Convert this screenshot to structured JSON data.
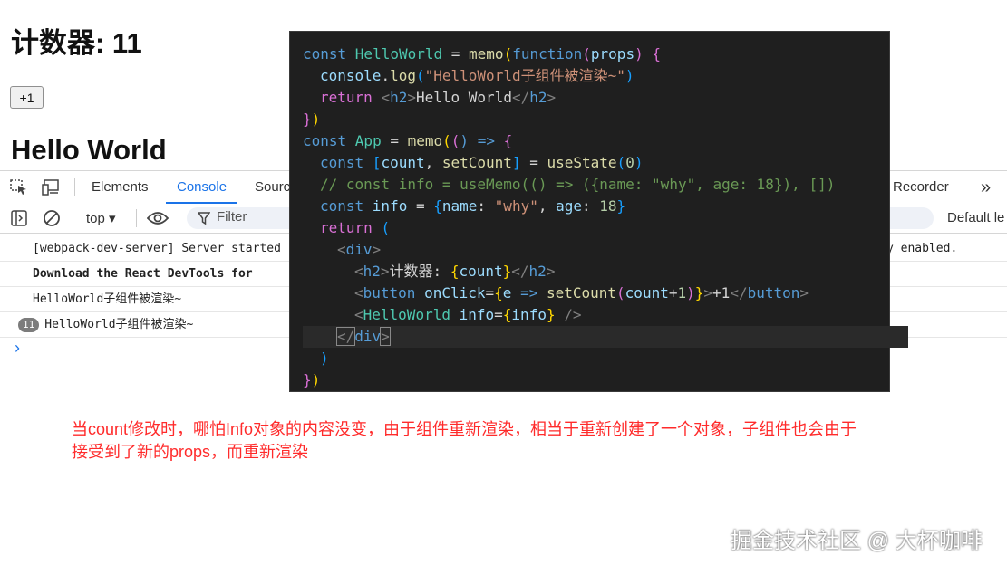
{
  "app": {
    "counter_title": "计数器: 11",
    "inc_button": "+1",
    "hello_title": "Hello World"
  },
  "devtools": {
    "tabs": [
      "Elements",
      "Console",
      "Sources",
      "Recorder"
    ],
    "active_tab": "Console",
    "context": "top ▾",
    "filter_placeholder": "Filter",
    "levels": "Default le",
    "logs": [
      "[webpack-dev-server] Server started",
      "Download the React DevTools for",
      "HelloWorld子组件被渲染~",
      "HelloWorld子组件被渲染~"
    ],
    "log_tail": "y enabled.",
    "repeat_count": "11",
    "prompt": "›",
    "more_tabs": "»"
  },
  "code": {
    "l1": [
      "const ",
      "HelloWorld",
      " = ",
      "memo",
      "(",
      "function",
      "(",
      "props",
      ") ",
      "{"
    ],
    "l2": [
      "console",
      ".",
      "log",
      "(",
      "\"HelloWorld子组件被渲染~\"",
      ")"
    ],
    "l3": [
      "return ",
      "<",
      "h2",
      ">",
      "Hello World",
      "</",
      "h2",
      ">"
    ],
    "l4": [
      "}",
      ")"
    ],
    "l5": [
      "const ",
      "App",
      " = ",
      "memo",
      "(",
      "(",
      ") => ",
      "{"
    ],
    "l6": [
      "const ",
      "[",
      "count",
      ", ",
      "setCount",
      "]",
      " = ",
      "useState",
      "(",
      "0",
      ")"
    ],
    "l7": "// const info = useMemo(() => ({name: \"why\", age: 18}), [])",
    "l8": [
      "const ",
      "info",
      " = ",
      "{",
      "name",
      ": ",
      "\"why\"",
      ", ",
      "age",
      ": ",
      "18",
      "}"
    ],
    "l9": [
      "return ",
      "("
    ],
    "l10": [
      "<",
      "div",
      ">"
    ],
    "l11": [
      "<",
      "h2",
      ">",
      "计数器: ",
      "{",
      "count",
      "}",
      "</",
      "h2",
      ">"
    ],
    "l12": [
      "<",
      "button ",
      "onClick",
      "=",
      "{",
      "e",
      " => ",
      "setCount",
      "(",
      "count",
      "+",
      "1",
      ")",
      "}",
      ">",
      "+1",
      "</",
      "button",
      ">"
    ],
    "l13": [
      "<",
      "HelloWorld ",
      "info",
      "=",
      "{",
      "info",
      "}",
      " />"
    ],
    "l14": [
      "</",
      "div",
      ">"
    ],
    "l15": [
      ")"
    ],
    "l16": [
      "}",
      ")"
    ]
  },
  "annotation": {
    "line1": "当count修改时，哪怕Info对象的内容没变，由于组件重新渲染，相当于重新创建了一个对象，子组件也会由于",
    "line2": "接受到了新的props，而重新渲染"
  },
  "watermark": "掘金技术社区 @ 大杯咖啡",
  "colors": {
    "accent": "#1a73e8",
    "annotation": "#ff2b2b",
    "editor_bg": "#1f1f1f"
  }
}
